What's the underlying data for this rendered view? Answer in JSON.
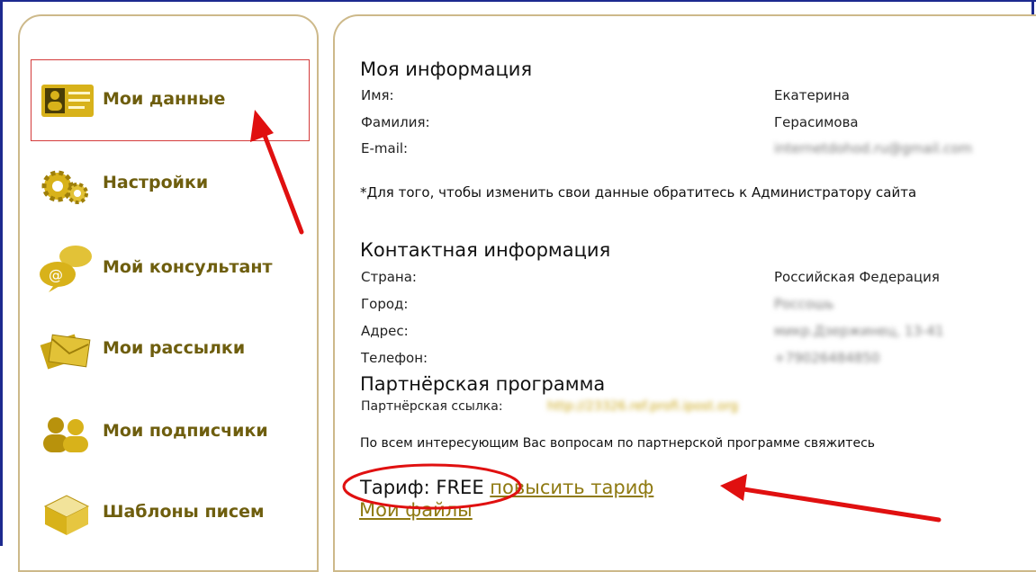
{
  "sidebar": {
    "items": [
      {
        "label": "Мои данные",
        "icon": "id-card-icon"
      },
      {
        "label": "Настройки",
        "icon": "gears-icon"
      },
      {
        "label": "Мой консультант",
        "icon": "chat-bubbles-icon"
      },
      {
        "label": "Мои рассылки",
        "icon": "envelopes-icon"
      },
      {
        "label": "Мои подписчики",
        "icon": "people-icon"
      },
      {
        "label": "Шаблоны писем",
        "icon": "templates-icon"
      }
    ]
  },
  "my_info": {
    "title": "Моя информация",
    "rows": [
      {
        "label": "Имя:",
        "value": "Екатерина"
      },
      {
        "label": "Фамилия:",
        "value": "Герасимова"
      },
      {
        "label": "E-mail:",
        "value": "internetdohod.ru@gmail.com"
      }
    ],
    "note": "*Для того, чтобы изменить свои данные обратитесь к Администратору сайта"
  },
  "contact_info": {
    "title": "Контактная информация",
    "rows": [
      {
        "label": "Страна:",
        "value": "Российская Федерация"
      },
      {
        "label": "Город:",
        "value": "Россошь"
      },
      {
        "label": "Адрес:",
        "value": "микр.Дзержинец, 13-41"
      },
      {
        "label": "Телефон:",
        "value": "+79026484850"
      }
    ]
  },
  "partner": {
    "title": "Партнёрская программа",
    "link_label": "Партнёрская ссылка:",
    "link_value": "http://23326.ref.profi.ipost.org",
    "contact_note": "По всем интересующим Вас вопросам по партнерской программе свяжитесь"
  },
  "tariff": {
    "label": "Тариф: FREE",
    "upgrade_link": "повысить тариф"
  },
  "files_link": "Мои файлы",
  "colors": {
    "accent": "#8f7a12",
    "panel_border": "#cdb98a",
    "annotation_red": "#e01010",
    "frame_blue": "#1d2a8f"
  }
}
